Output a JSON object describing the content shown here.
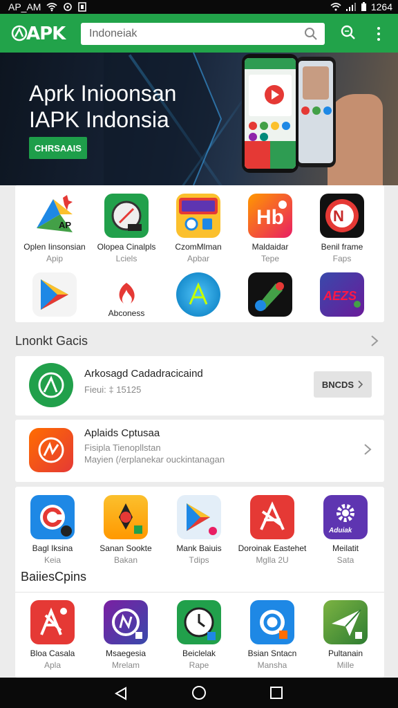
{
  "status_bar": {
    "left_text": "AP_AM",
    "time": "1264"
  },
  "header": {
    "logo": "APK",
    "search_value": "Indoneiak"
  },
  "banner": {
    "title_line1": "Aprk Inioonsan",
    "title_line2": "IAPK Indonsia",
    "button": "CHRSAAIS"
  },
  "featured_apps": [
    {
      "name": "Oplen Iinsonsian",
      "sub": "Apip"
    },
    {
      "name": "Olopea Cinalpls",
      "sub": "Lciels"
    },
    {
      "name": "CzomMlman",
      "sub": "Apbar"
    },
    {
      "name": "Maldaidar",
      "sub": "Tepe"
    },
    {
      "name": "Benil frame",
      "sub": "Faps"
    },
    {
      "name": "",
      "sub": ""
    },
    {
      "name": "Abconess",
      "sub": ""
    },
    {
      "name": "",
      "sub": ""
    },
    {
      "name": "",
      "sub": ""
    },
    {
      "name": "",
      "sub": ""
    }
  ],
  "section1": {
    "title": "Lnonkt Gacis"
  },
  "list": [
    {
      "title": "Arkosagd Cadadracicaind",
      "sub": "Fieui: ‡ 15125",
      "button": "BNCDS"
    },
    {
      "title": "Aplaids Cptusaa",
      "sub": "Fisipla Tienopllstan",
      "sub2": "Mayien (/erplanekar ouckintanagan"
    }
  ],
  "apps_row2": [
    {
      "name": "Bagl Iksina",
      "sub": "Keia"
    },
    {
      "name": "Sanan Sookte",
      "sub": "Bakan"
    },
    {
      "name": "Mank Baiuis",
      "sub": "Tdips"
    },
    {
      "name": "Doroinak Eastehet",
      "sub": "Mglla 2U"
    },
    {
      "name": "Meilatit",
      "sub": "Sata"
    }
  ],
  "section2": {
    "title": "BaiiesCpins"
  },
  "apps_row3": [
    {
      "name": "Bloa Casala",
      "sub": "Apla"
    },
    {
      "name": "Msaegesia",
      "sub": "Mrelam"
    },
    {
      "name": "Beiclelak",
      "sub": "Rape"
    },
    {
      "name": "Bsian Sntacn",
      "sub": "Mansha"
    },
    {
      "name": "Pultanain",
      "sub": "Mille"
    }
  ],
  "icon_text": {
    "apk_label": "AP",
    "maldaidar_label": "Hb",
    "benil_label": "N",
    "alz_label": "AEZS",
    "adujak_label": "Aduiak"
  },
  "colors": {
    "brand_green": "#22a34a",
    "cta_green": "#1e9e4a",
    "background": "#ececec"
  }
}
